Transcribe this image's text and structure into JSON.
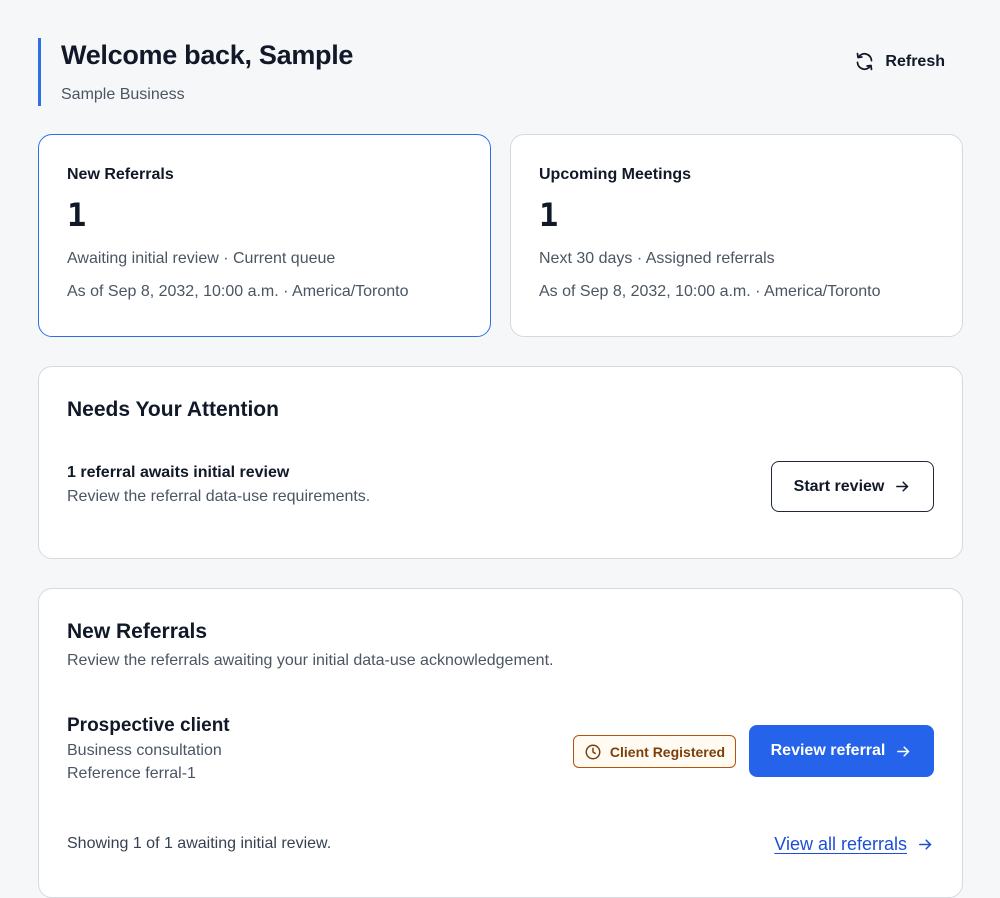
{
  "header": {
    "title": "Welcome back, Sample",
    "subtitle": "Sample Business",
    "refresh_label": "Refresh"
  },
  "stats": [
    {
      "label": "New Referrals",
      "value": "1",
      "meta": "Awaiting initial review · Current queue",
      "as_of": "As of Sep 8, 2032, 10:00 a.m. · America/Toronto"
    },
    {
      "label": "Upcoming Meetings",
      "value": "1",
      "meta": "Next 30 days · Assigned referrals",
      "as_of": "As of Sep 8, 2032, 10:00 a.m. · America/Toronto"
    }
  ],
  "attention": {
    "title": "Needs Your Attention",
    "item_title": "1 referral awaits initial review",
    "item_desc": "Review the referral data-use requirements.",
    "button_label": "Start review"
  },
  "referrals": {
    "title": "New Referrals",
    "description": "Review the referrals awaiting your initial data-use acknowledgement.",
    "items": [
      {
        "name": "Prospective client",
        "type": "Business consultation",
        "reference": "Reference ferral-1",
        "badge": "Client Registered",
        "action": "Review referral"
      }
    ],
    "showing": "Showing 1 of 1 awaiting initial review.",
    "view_all": "View all referrals"
  },
  "colors": {
    "accent": "#2f6fe4",
    "primary_button": "#2563eb",
    "badge_border": "#b45309",
    "link": "#1d4ed8"
  },
  "icons": {
    "refresh": "refresh-icon",
    "arrow": "arrow-right-icon",
    "clock": "clock-icon"
  }
}
